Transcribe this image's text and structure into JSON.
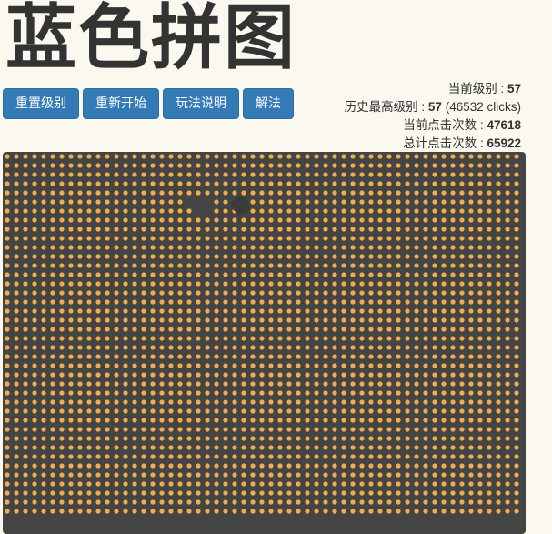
{
  "title": "蓝色拼图",
  "toolbar": {
    "reset_level": "重置级别",
    "restart": "重新开始",
    "how_to_play": "玩法说明",
    "solution": "解法"
  },
  "stats": {
    "current_level_label": "当前级别 : ",
    "current_level": "57",
    "best_level_label": "历史最高级别 : ",
    "best_level": "57",
    "best_level_clicks": "(46532 clicks)",
    "current_clicks_label": "当前点击次数 : ",
    "current_clicks": "47618",
    "total_clicks_label": "总计点击次数 : ",
    "total_clicks": "65922"
  },
  "board": {
    "background": "#444444",
    "dot_color": "#f0ad4e",
    "empty_color": "#444444",
    "visible_columns": 57,
    "visible_rows": 40,
    "empty_cells": [
      [
        20,
        5
      ],
      [
        21,
        5
      ],
      [
        21,
        6
      ],
      [
        22,
        5
      ],
      [
        22,
        6
      ]
    ]
  }
}
